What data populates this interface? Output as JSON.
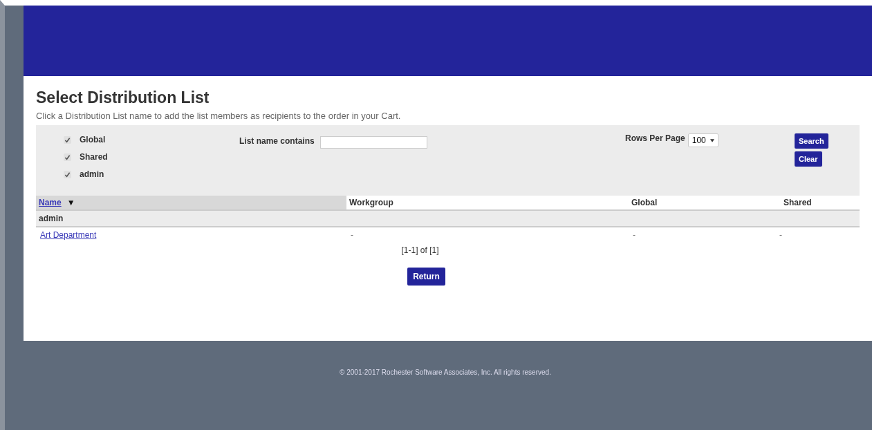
{
  "title": "Select Distribution List",
  "description": "Click a Distribution List name to add the list members as recipients to the order in your Cart.",
  "filters": [
    {
      "label": "Global",
      "checked": true
    },
    {
      "label": "Shared",
      "checked": true
    },
    {
      "label": "admin",
      "checked": true
    }
  ],
  "search": {
    "label": "List name contains"
  },
  "rows_per_page": {
    "label": "Rows Per Page",
    "value": "100"
  },
  "buttons": [
    "Search",
    "Clear"
  ],
  "table": {
    "columns": [
      {
        "label": "Name",
        "sort": "▼"
      },
      {
        "label": "Workgroup"
      },
      {
        "label": "Global"
      },
      {
        "label": "Shared"
      }
    ],
    "groups": [
      {
        "name": "admin",
        "rows": [
          {
            "cells": [
              "Art Department",
              "-",
              "-",
              "-"
            ]
          }
        ]
      }
    ]
  },
  "pager": "[1-1] of [1]",
  "return_button": "Return",
  "footer": "© 2001-2017 Rochester Software Associates, Inc. All rights reserved."
}
